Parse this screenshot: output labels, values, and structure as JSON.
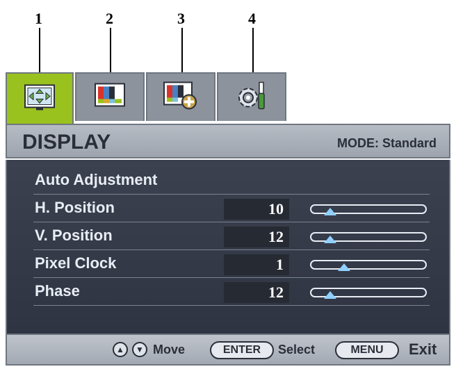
{
  "callouts": [
    "1",
    "2",
    "3",
    "4"
  ],
  "tabs": [
    {
      "icon": "display-arrows-icon",
      "active": true
    },
    {
      "icon": "picture-color-bars-icon",
      "active": false
    },
    {
      "icon": "picture-advanced-icon",
      "active": false
    },
    {
      "icon": "system-gear-icon",
      "active": false
    }
  ],
  "header": {
    "title": "DISPLAY",
    "mode": "MODE: Standard"
  },
  "menu": [
    {
      "label": "Auto Adjustment",
      "value": null,
      "slider": null
    },
    {
      "label": "H. Position",
      "value": "10",
      "slider": 0.12
    },
    {
      "label": "V. Position",
      "value": "12",
      "slider": 0.12
    },
    {
      "label": "Pixel Clock",
      "value": "1",
      "slider": 0.26
    },
    {
      "label": "Phase",
      "value": "12",
      "slider": 0.12
    }
  ],
  "footer": {
    "move_label": "Move",
    "enter_label": "ENTER",
    "select_label": "Select",
    "menu_label": "MENU",
    "exit_label": "Exit"
  },
  "colors": {
    "active_tab": "#9ac21e",
    "knob": "#8fd0ff",
    "panel": "#3c4150"
  }
}
